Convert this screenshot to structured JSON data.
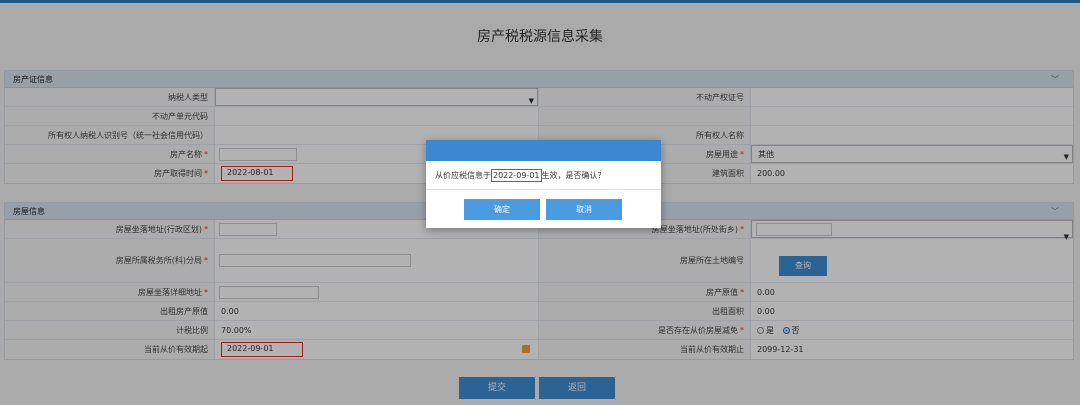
{
  "page": {
    "title": "房产税税源信息采集"
  },
  "section1": {
    "title": "房产证信息",
    "rows": [
      {
        "l1": "纳税人类型",
        "l2": "不动产权证号"
      },
      {
        "l1": "不动产单元代码",
        "l2": ""
      },
      {
        "l1": "所有权人纳税人识别号（统一社会信用代码）",
        "l2": "所有权人名称"
      },
      {
        "l1": "房产名称",
        "l2": "房屋用途",
        "v2": "其他"
      },
      {
        "l1": "房产取得时间",
        "v1": "2022-08-01",
        "l2": "建筑面积",
        "v2": "200.00"
      }
    ]
  },
  "section2": {
    "title": "房屋信息",
    "rows": [
      {
        "l1": "房屋坐落地址(行政区划)",
        "l2": "房屋坐落地址(所处街乡)"
      },
      {
        "l1": "房屋所属税务所(科)分局",
        "l2": "房屋所在土地编号",
        "btn": "查询"
      },
      {
        "l1": "房屋坐落详细地址",
        "l2": "房产原值",
        "v2": "0.00"
      },
      {
        "l1": "出租房产原值",
        "v1": "0.00",
        "l2": "出租面积",
        "v2": "0.00"
      },
      {
        "l1": "计税比例",
        "v1": "70.00%",
        "l2": "是否存在从价房屋减免",
        "yes": "是",
        "no": "否"
      },
      {
        "l1": "当前从价有效期起",
        "v1": "2022-09-01",
        "l2": "当前从价有效期止",
        "v2": "2099-12-31"
      }
    ]
  },
  "req_mark": "*",
  "bottom": {
    "submit": "提交",
    "back": "返回"
  },
  "dialog": {
    "msg_pre": "从价应税信息于",
    "msg_date": "2022-09-01",
    "msg_post": "生效，是否确认？",
    "ok": "确定",
    "cancel": "取消"
  },
  "colors": {
    "primary": "#3f8fd6",
    "highlight": "#e03030",
    "header": "#dbe4ef"
  }
}
